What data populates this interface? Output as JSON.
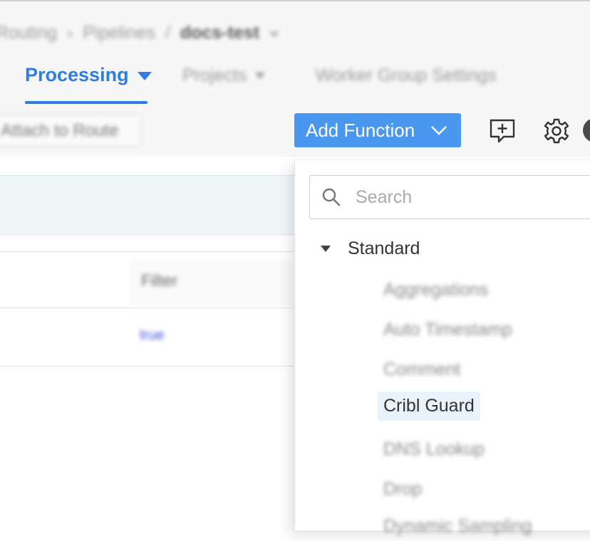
{
  "breadcrumb": {
    "items": [
      "Routing",
      "Pipelines",
      "docs-test"
    ]
  },
  "nav": {
    "tabs": [
      {
        "label": "Processing",
        "active": true
      },
      {
        "label": "Projects"
      },
      {
        "label": "Worker Group Settings"
      }
    ]
  },
  "toolbar": {
    "attach_label": "Attach to Route",
    "add_function_label": "Add Function"
  },
  "table": {
    "filter_header": "Filter",
    "row_filter_value": "true"
  },
  "dropdown": {
    "search_placeholder": "Search",
    "group_label": "Standard",
    "items": [
      {
        "label": "Aggregations"
      },
      {
        "label": "Auto Timestamp"
      },
      {
        "label": "Comment"
      },
      {
        "label": "Cribl Guard",
        "highlighted": true
      },
      {
        "label": "DNS Lookup"
      },
      {
        "label": "Drop"
      },
      {
        "label": "Dynamic Sampling"
      }
    ]
  },
  "colors": {
    "accent": "#2f7de1",
    "button_bg": "#4a97f0",
    "highlight_bg": "#e9f3fc"
  }
}
